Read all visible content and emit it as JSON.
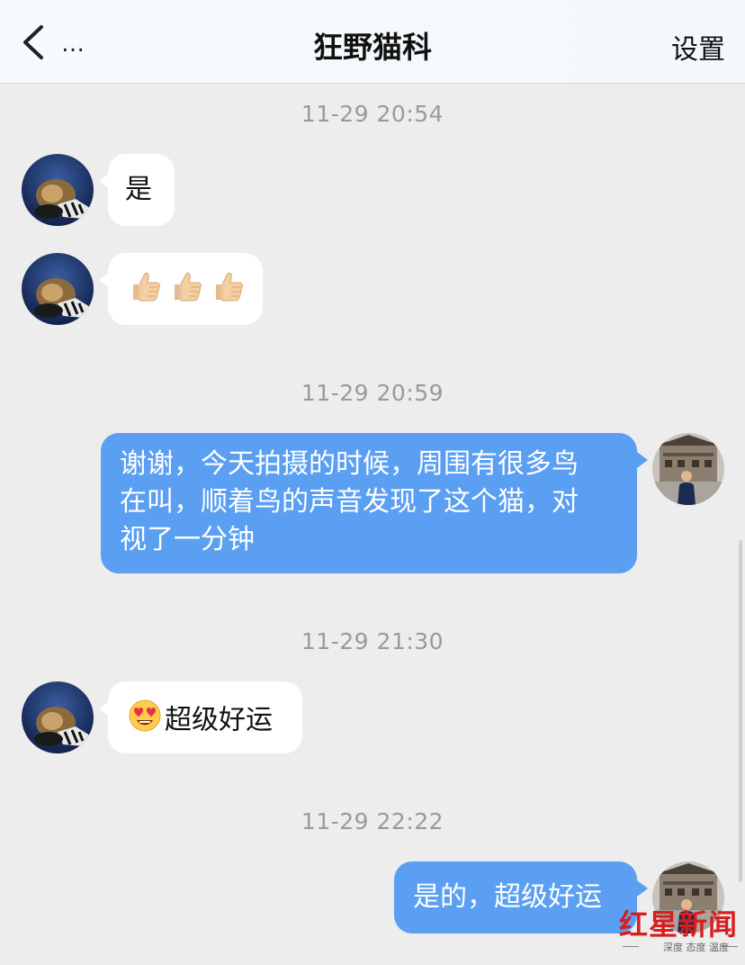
{
  "nav": {
    "back_icon": "chevron-left-icon",
    "more_label": "…",
    "title": "狂野猫科",
    "settings_label": "设置"
  },
  "messages": [
    {
      "timestamp": "11-29 20:54",
      "side": "left",
      "text": "是"
    },
    {
      "side": "left",
      "emoji": [
        "thumbs-up-icon",
        "thumbs-up-icon",
        "thumbs-up-icon"
      ]
    },
    {
      "timestamp": "11-29 20:59",
      "side": "right",
      "lines": [
        "谢谢，今天拍摄的时候，周围有很多鸟",
        "在叫，顺着鸟的声音发现了这个猫，对",
        "视了一分钟"
      ]
    },
    {
      "timestamp": "11-29 21:30",
      "side": "left",
      "emoji_icon": "heart-eyes-face-icon",
      "text": "超级好运"
    },
    {
      "timestamp": "11-29 22:22",
      "side": "right",
      "text": "是的，超级好运"
    }
  ],
  "watermark": {
    "brand": "红星新闻",
    "slogan": "深度 态度 温度"
  },
  "colors": {
    "background": "#ededed",
    "outgoing_bubble": "#5a9ff2",
    "incoming_bubble": "#ffffff",
    "timestamp": "#9a9a9a",
    "watermark_red": "#d81e1e"
  }
}
